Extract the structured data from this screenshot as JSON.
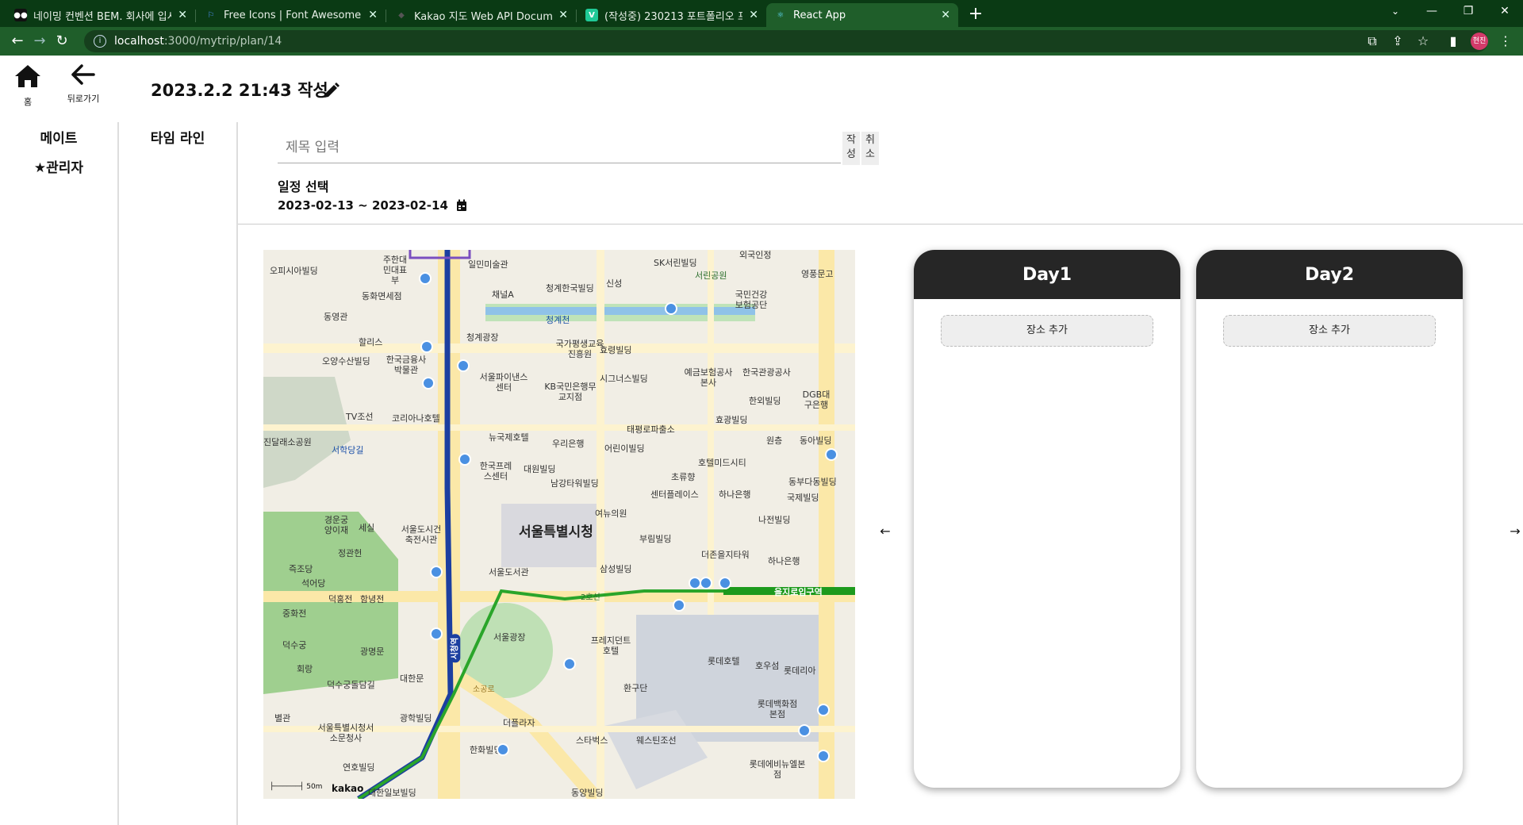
{
  "browser": {
    "tabs": [
      {
        "title": "네이밍 컨벤션 BEM. 회사에 입시",
        "fav_color": "#111111",
        "fav_text": "●●"
      },
      {
        "title": "Free Icons | Font Awesome",
        "fav_color": "#1b5fc1",
        "fav_text": "⚐"
      },
      {
        "title": "Kakao 지도 Web API Document",
        "fav_color": "#222222",
        "fav_text": "◆"
      },
      {
        "title": "(작성중) 230213 포트폴리오 프로",
        "fav_color": "#20c997",
        "fav_text": "V"
      },
      {
        "title": "React App",
        "fav_color": "#61dafb",
        "fav_text": "⚛"
      }
    ],
    "active_tab": 4,
    "url_host": "localhost",
    "url_path": ":3000/mytrip/plan/14",
    "profile_text": "현진"
  },
  "header": {
    "home_label": "홈",
    "back_label": "뒤로가기",
    "title": "2023.2.2 21:43 작성"
  },
  "sidebar_mate": {
    "heading": "메이트",
    "items": [
      {
        "label": "관리자"
      }
    ]
  },
  "sidebar_timeline": {
    "heading": "타임 라인"
  },
  "form": {
    "title_placeholder": "제목 입력",
    "title_value": "",
    "submit_label": "작성",
    "cancel_label": "취소",
    "schedule_label": "일정 선택",
    "date_range": "2023-02-13 ~ 2023-02-14"
  },
  "map": {
    "city_hall": "서울특별시청",
    "labels": {
      "a": "오피시아빌딩",
      "b": "주한대민대표부",
      "c": "일민미술관",
      "d": "청계한국빌딩",
      "e": "신성",
      "f": "SK서린빌딩",
      "g": "서린공원",
      "h": "외국인정",
      "i": "영풍문고",
      "j": "동화면세점",
      "k": "채널A",
      "l": "국민건강보험공단",
      "m": "동영관",
      "n": "청계광장",
      "o": "청계천",
      "p": "할리스",
      "q": "오양수산빌딩",
      "r": "한국금융사박물관",
      "s": "국가평생교육진흥원",
      "t": "효령빌딩",
      "u": "서울파이낸스센터",
      "v": "KB국민은행무교지점",
      "w": "시그너스빌딩",
      "x": "예금보험공사본사",
      "y": "한국관광공사",
      "z": "한외빌딩",
      "aa": "DGB대구은행",
      "ab": "TV조선",
      "ac": "코리아나호텔",
      "ad": "뉴국제호텔",
      "ae": "우리은행",
      "af": "태평로파출소",
      "ag": "효광빌딩",
      "ah": "진달래소공원",
      "ai": "서학당길",
      "aj": "원층",
      "ak": "동아빌딩",
      "al": "어린이빌딩",
      "am": "한국프레스센터",
      "an": "대원빌딩",
      "ao": "남강타워빌딩",
      "ap": "초류향",
      "aq": "호텔미드시티",
      "ar": "동부다동빌딩",
      "as": "센터플레이스",
      "at": "하나은행",
      "au": "국제빌딩",
      "av": "여뉴의원",
      "aw": "경운궁양이재",
      "ax": "세실",
      "ay": "서울도시건축전시관",
      "az": "나전빌딩",
      "ba": "부림빌딩",
      "bb": "정관헌",
      "bc": "더존을지타워",
      "bd": "하나은행",
      "be": "즉조당",
      "bf": "석어당",
      "bg": "삼성빌딩",
      "bh": "서울도서관",
      "bi": "덕홍전",
      "bj": "함녕전",
      "bk": "을지로입구역",
      "bl": "중화전",
      "bm": "서울광장",
      "bn": "덕수궁",
      "bo": "광명문",
      "bp": "프레지던트호텔",
      "bq": "회랑",
      "br": "롯데호텔",
      "bs": "호우섬",
      "bt": "롯데리아",
      "bu": "대한문",
      "bv": "덕수궁돌담길",
      "bw": "환구단",
      "bx": "별관",
      "by": "광학빌딩",
      "bz": "서울특별시청서소문청사",
      "ca": "더플라자",
      "cb": "롯데백화점본점",
      "cc": "스타벅스",
      "cd": "웨스틴조선",
      "ce": "한화빌딩",
      "cf": "연호빌딩",
      "cg": "롯데에비뉴엘본점",
      "ch": "동양빌딩",
      "ci": "대한일보빌딩",
      "cj": "시청역",
      "ck": "2호선",
      "cl": "소공로"
    },
    "logo": "kakao",
    "scale": "50m"
  },
  "days": [
    {
      "title": "Day1",
      "add_label": "장소 추가"
    },
    {
      "title": "Day2",
      "add_label": "장소 추가"
    }
  ],
  "carousel": {
    "prev": "←",
    "next": "→"
  }
}
